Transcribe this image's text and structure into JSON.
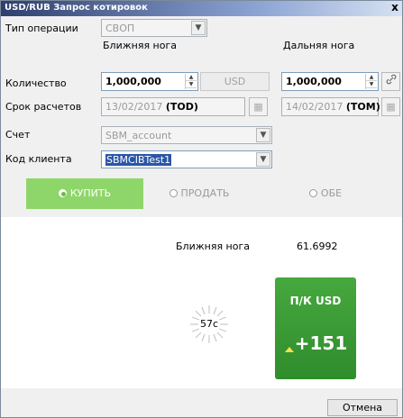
{
  "window": {
    "title": "USD/RUB Запрос котировок",
    "close": "x"
  },
  "labels": {
    "operation_type": "Тип операции",
    "quantity": "Количество",
    "settlement": "Срок расчетов",
    "account": "Счет",
    "client_code": "Код клиента",
    "near_leg": "Ближняя нога",
    "far_leg": "Дальняя нога"
  },
  "form": {
    "operation_type_value": "СВОП",
    "near_quantity": "1,000,000",
    "currency_button": "USD",
    "far_quantity": "1,000,000",
    "near_date": "13/02/2017",
    "near_date_tag": "(TOD)",
    "far_date": "14/02/2017",
    "far_date_tag": "(TOM)",
    "account_value": "SBM_account",
    "client_code_value": "SBMCIBTest1"
  },
  "side": {
    "buy": "КУПИТЬ",
    "sell": "ПРОДАТЬ",
    "both": "ОБЕ",
    "selected": "buy"
  },
  "quote": {
    "leg_label": "Ближняя нога",
    "leg_rate": "61.6992",
    "countdown": "57c",
    "box_title": "П/К USD",
    "box_value": "+151"
  },
  "footer": {
    "cancel": "Отмена"
  },
  "colors": {
    "accent_green": "#8fd66a",
    "quote_green": "#3a9a34",
    "title_bar": "#2f3f6e"
  },
  "icons": {
    "link": "link-icon",
    "calendar": "calendar-icon",
    "dropdown": "chevron-down-icon",
    "spinner": "loading-spinner-icon",
    "up_arrow": "up-arrow-icon"
  }
}
